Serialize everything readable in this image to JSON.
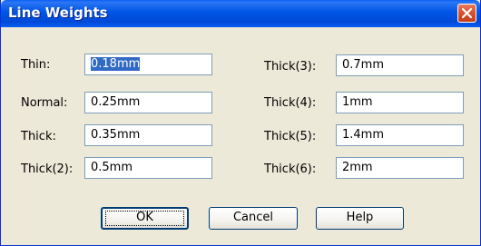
{
  "window": {
    "title": "Line Weights"
  },
  "left_fields": [
    {
      "label": "Thin:",
      "value": "0.18mm",
      "selected": true
    },
    {
      "label": "Normal:",
      "value": "0.25mm"
    },
    {
      "label": "Thick:",
      "value": "0.35mm"
    },
    {
      "label": "Thick(2):",
      "value": "0.5mm"
    }
  ],
  "right_fields": [
    {
      "label": "Thick(3):",
      "value": "0.7mm"
    },
    {
      "label": "Thick(4):",
      "value": "1mm"
    },
    {
      "label": "Thick(5):",
      "value": "1.4mm"
    },
    {
      "label": "Thick(6):",
      "value": "2mm"
    }
  ],
  "buttons": {
    "ok": "OK",
    "cancel": "Cancel",
    "help": "Help"
  },
  "icons": {
    "close": "close-icon"
  },
  "colors": {
    "titlebar": "#0055e5",
    "close": "#d6512c",
    "background": "#ece9d8",
    "selection": "#316ac5"
  }
}
